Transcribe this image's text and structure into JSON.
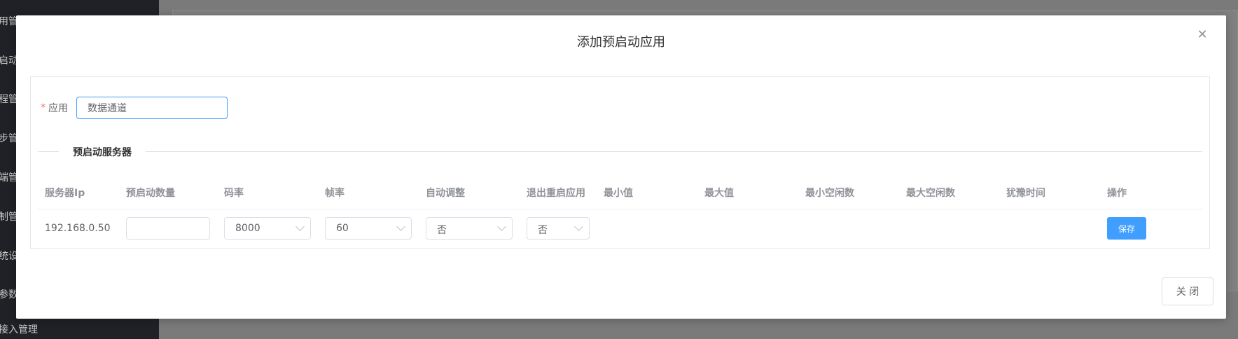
{
  "background": {
    "sidebar_items": [
      "用管",
      "启动",
      "程管",
      "步管",
      "端管",
      "制管",
      "统设",
      "参数",
      "接入管理"
    ]
  },
  "modal": {
    "title": "添加预启动应用",
    "close_icon": "close-icon",
    "form": {
      "required_mark": "*",
      "app_label": "应用",
      "app_value": "数据通道"
    },
    "section_title": "预启动服务器",
    "table": {
      "headers": [
        "服务器Ip",
        "预启动数量",
        "码率",
        "帧率",
        "自动调整",
        "退出重启应用",
        "最小值",
        "最大值",
        "最小空闲数",
        "最大空闲数",
        "犹豫时间",
        "操作"
      ],
      "row": {
        "server_ip": "192.168.0.50",
        "prestart_count": "",
        "bitrate": "8000",
        "framerate": "60",
        "auto_adjust": "否",
        "restart_on_exit": "否",
        "min": "",
        "max": "",
        "min_idle": "",
        "max_idle": "",
        "hesitation_time": "",
        "save_label": "保存"
      }
    },
    "close_button": "关 闭"
  },
  "colors": {
    "primary": "#409eff",
    "required": "#f56c6c",
    "overlay": "#7f7f7f"
  }
}
